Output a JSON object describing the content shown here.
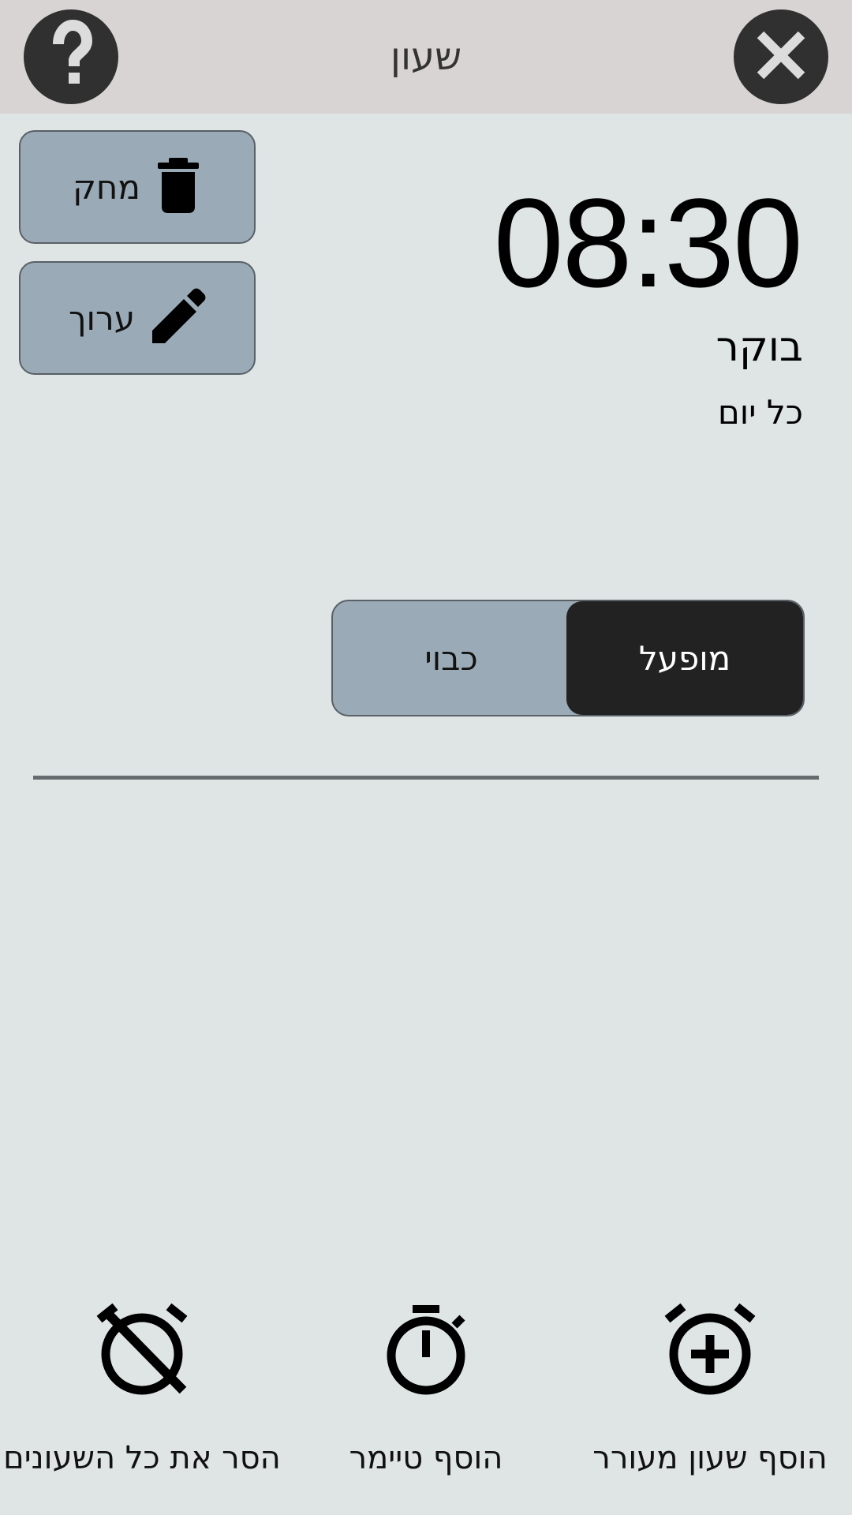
{
  "header": {
    "title": "שעון"
  },
  "actions": {
    "delete_label": "מחק",
    "edit_label": "ערוך"
  },
  "alarm": {
    "time": "08:30",
    "label": "בוקר",
    "repeat": "כל יום",
    "toggle_off_label": "כבוי",
    "toggle_on_label": "מופעל",
    "enabled": true
  },
  "bottom_actions": {
    "remove_all_label": "הסר את כל השעונים",
    "add_timer_label": "הוסף טיימר",
    "add_alarm_label": "הוסף שעון מעורר"
  },
  "colors": {
    "background": "#dfe4e5",
    "topbar": "#d8d4d4",
    "button": "#9aabb7",
    "toggle_on": "#222222",
    "circle_button": "#303030"
  },
  "icons": {
    "help": "help-icon",
    "close": "close-icon",
    "delete": "trash-icon",
    "edit": "pencil-icon",
    "remove_all": "alarm-off-icon",
    "timer": "stopwatch-icon",
    "add_alarm": "alarm-add-icon"
  }
}
